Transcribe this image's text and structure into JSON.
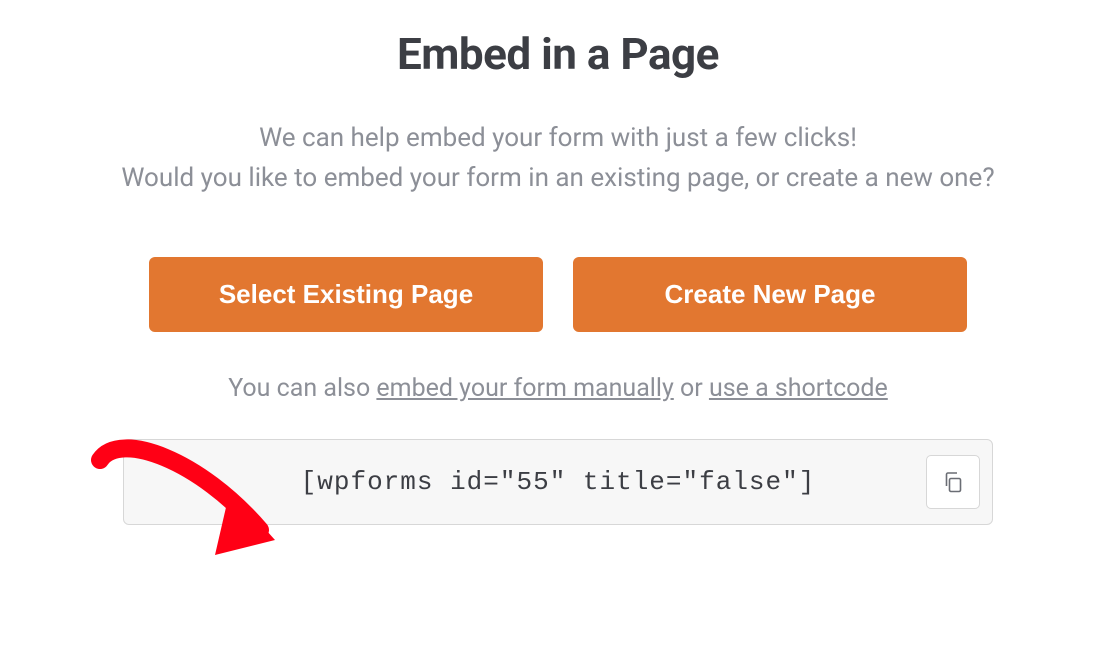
{
  "heading": "Embed in a Page",
  "subtitle_line1": "We can help embed your form with just a few clicks!",
  "subtitle_line2": "Would you like to embed your form in an existing page, or create a new one?",
  "buttons": {
    "select_existing": "Select Existing Page",
    "create_new": "Create New Page"
  },
  "secondary": {
    "prefix": "You can also ",
    "link_manual": "embed your form manually",
    "middle": " or ",
    "link_shortcode": "use a shortcode"
  },
  "shortcode": "[wpforms id=\"55\" title=\"false\"]",
  "colors": {
    "accent": "#e27730",
    "text_dark": "#3c3e44",
    "text_muted": "#8c8f97",
    "box_bg": "#f7f7f7",
    "annotation": "#ff0015"
  }
}
